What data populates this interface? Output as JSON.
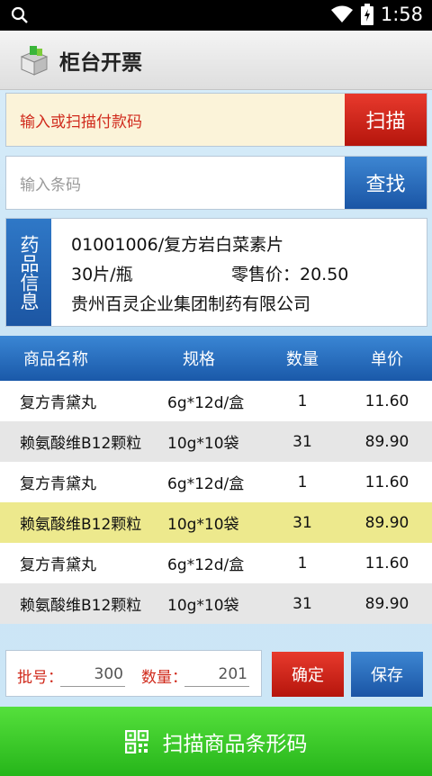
{
  "status": {
    "time": "1:58"
  },
  "app": {
    "title": "柜台开票"
  },
  "payment": {
    "placeholder": "输入或扫描付款码",
    "button": "扫描"
  },
  "barcode": {
    "placeholder": "输入条码",
    "button": "查找"
  },
  "drug_info": {
    "tag": "药品信息",
    "line1": "01001006/复方岩白菜素片",
    "spec": "30片/瓶",
    "price": "零售价：20.50",
    "maker": "贵州百灵企业集团制药有限公司"
  },
  "table": {
    "headers": [
      "商品名称",
      "规格",
      "数量",
      "单价"
    ],
    "rows": [
      [
        "复方青黛丸",
        "6g*12d/盒",
        "1",
        "11.60"
      ],
      [
        "赖氨酸维B12颗粒",
        "10g*10袋",
        "31",
        "89.90"
      ],
      [
        "复方青黛丸",
        "6g*12d/盒",
        "1",
        "11.60"
      ],
      [
        "赖氨酸维B12颗粒",
        "10g*10袋",
        "31",
        "89.90"
      ],
      [
        "复方青黛丸",
        "6g*12d/盒",
        "1",
        "11.60"
      ],
      [
        "赖氨酸维B12颗粒",
        "10g*10袋",
        "31",
        "89.90"
      ]
    ],
    "selected_row": 3
  },
  "entry": {
    "batch_label": "批号：",
    "batch_value": "300",
    "qty_label": "数量：",
    "qty_value": "201",
    "confirm": "确定",
    "save": "保存"
  },
  "scan_button": {
    "label": "扫描商品条形码",
    "icon": "qr-icon"
  },
  "colors": {
    "red": "#c8241a",
    "blue": "#1f5fae",
    "green": "#36c72a",
    "highlight": "#ede98d"
  }
}
